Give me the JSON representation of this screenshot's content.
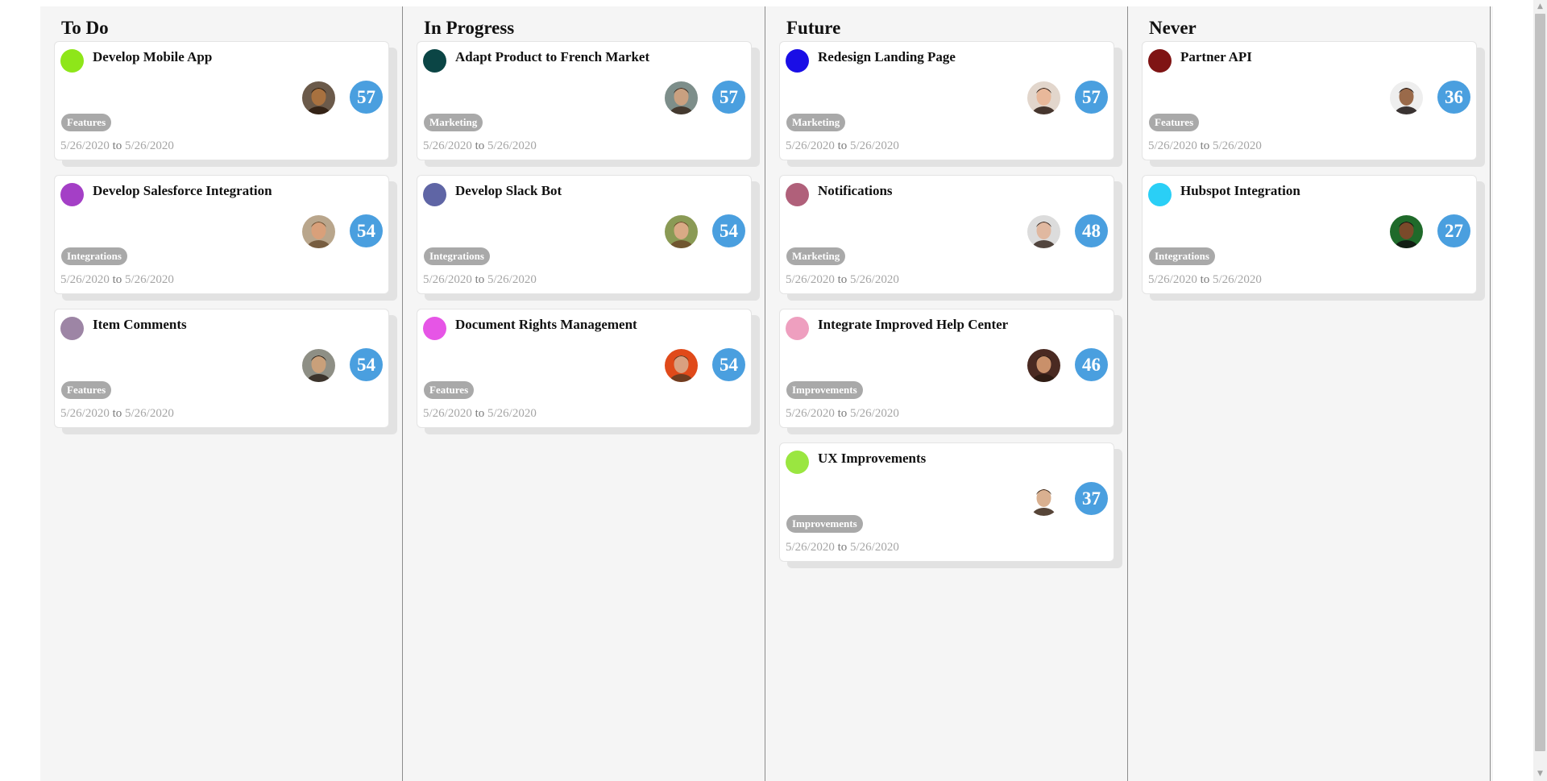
{
  "columns": [
    {
      "title": "To Do",
      "cards": [
        {
          "title": "Develop Mobile App",
          "color": "#8ee619",
          "avatar": {
            "skin": "#a8713f",
            "hair": "#2a1a0d",
            "bg": "#6b5a4a"
          },
          "count": "57",
          "tag": "Features",
          "start": "5/26/2020",
          "to": "to",
          "end": "5/26/2020"
        },
        {
          "title": "Develop Salesforce Integration",
          "color": "#a43fc6",
          "avatar": {
            "skin": "#d9a07a",
            "hair": "#6b5033",
            "bg": "#b9a68c"
          },
          "count": "54",
          "tag": "Integrations",
          "start": "5/26/2020",
          "to": "to",
          "end": "5/26/2020"
        },
        {
          "title": "Item Comments",
          "color": "#9d85a5",
          "avatar": {
            "skin": "#c9a07a",
            "hair": "#2e241c",
            "bg": "#8e8f85"
          },
          "count": "54",
          "tag": "Features",
          "start": "5/26/2020",
          "to": "to",
          "end": "5/26/2020"
        }
      ]
    },
    {
      "title": "In Progress",
      "cards": [
        {
          "title": "Adapt Product to French Market",
          "color": "#0b4545",
          "avatar": {
            "skin": "#c9a080",
            "hair": "#3a2a1f",
            "bg": "#7d8e8a"
          },
          "count": "57",
          "tag": "Marketing",
          "start": "5/26/2020",
          "to": "to",
          "end": "5/26/2020"
        },
        {
          "title": "Develop Slack Bot",
          "color": "#5f65a5",
          "avatar": {
            "skin": "#d9aa85",
            "hair": "#6b4a2a",
            "bg": "#8a9a55"
          },
          "count": "54",
          "tag": "Integrations",
          "start": "5/26/2020",
          "to": "to",
          "end": "5/26/2020"
        },
        {
          "title": "Document Rights Management",
          "color": "#e655e6",
          "avatar": {
            "skin": "#d9a080",
            "hair": "#5a3a22",
            "bg": "#e04a1a"
          },
          "count": "54",
          "tag": "Features",
          "start": "5/26/2020",
          "to": "to",
          "end": "5/26/2020"
        }
      ]
    },
    {
      "title": "Future",
      "cards": [
        {
          "title": "Redesign Landing Page",
          "color": "#1a0ee6",
          "avatar": {
            "skin": "#e8b89a",
            "hair": "#2a1a12",
            "bg": "#e2d6cc"
          },
          "count": "57",
          "tag": "Marketing",
          "start": "5/26/2020",
          "to": "to",
          "end": "5/26/2020"
        },
        {
          "title": "Notifications",
          "color": "#b0607a",
          "avatar": {
            "skin": "#e0b8a0",
            "hair": "#3a2a22",
            "bg": "#dcdcdc"
          },
          "count": "48",
          "tag": "Marketing",
          "start": "5/26/2020",
          "to": "to",
          "end": "5/26/2020"
        },
        {
          "title": "Integrate Improved Help Center",
          "color": "#ee9fbf",
          "avatar": {
            "skin": "#c9906a",
            "hair": "#2a1a12",
            "bg": "#4a2a22"
          },
          "count": "46",
          "tag": "Improvements",
          "start": "5/26/2020",
          "to": "to",
          "end": "5/26/2020"
        },
        {
          "title": "UX Improvements",
          "color": "#9ae640",
          "avatar": {
            "skin": "#d9b090",
            "hair": "#3a2515",
            "bg": "#ffffff"
          },
          "count": "37",
          "tag": "Improvements",
          "start": "5/26/2020",
          "to": "to",
          "end": "5/26/2020"
        }
      ]
    },
    {
      "title": "Never",
      "cards": [
        {
          "title": "Partner API",
          "color": "#7f1414",
          "avatar": {
            "skin": "#9a6a4a",
            "hair": "#1a1210",
            "bg": "#eeeeee"
          },
          "count": "36",
          "tag": "Features",
          "start": "5/26/2020",
          "to": "to",
          "end": "5/26/2020"
        },
        {
          "title": "Hubspot Integration",
          "color": "#2acff6",
          "avatar": {
            "skin": "#7a4a2a",
            "hair": "#111111",
            "bg": "#1f6a2a"
          },
          "count": "27",
          "tag": "Integrations",
          "start": "5/26/2020",
          "to": "to",
          "end": "5/26/2020"
        }
      ]
    }
  ],
  "scrollbar": {
    "up_icon": "arrow-up-icon",
    "down_icon": "arrow-down-icon"
  }
}
